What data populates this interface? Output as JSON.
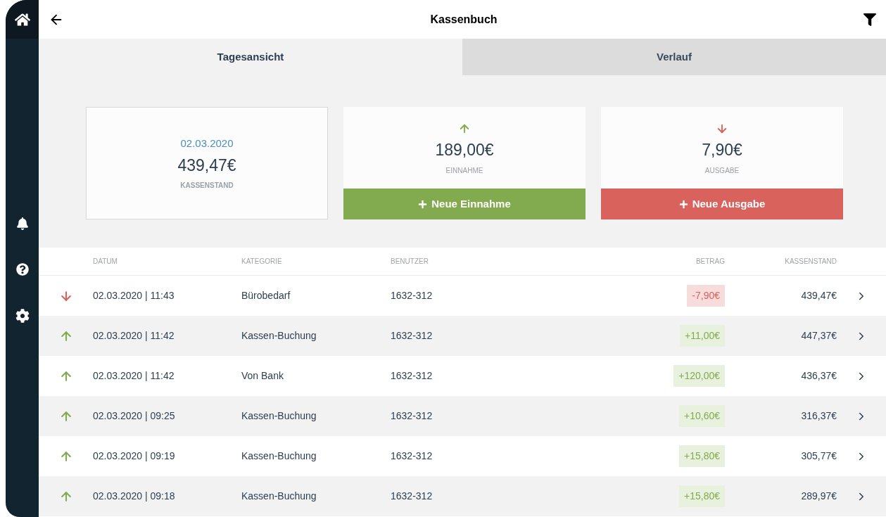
{
  "header": {
    "title": "Kassenbuch"
  },
  "tabs": [
    {
      "label": "Tagesansicht",
      "selected": true
    },
    {
      "label": "Verlauf",
      "selected": false
    }
  ],
  "balance_card": {
    "date": "02.03.2020",
    "amount": "439,47€",
    "label": "KASSENSTAND"
  },
  "summary_cards": [
    {
      "kind": "in",
      "amount": "189,00€",
      "label": "EINNAHME",
      "button": "Neue Einnahme"
    },
    {
      "kind": "out",
      "amount": "7,90€",
      "label": "AUSGABE",
      "button": "Neue Ausgabe"
    }
  ],
  "table": {
    "columns": [
      "DATUM",
      "KATEGORIE",
      "BENUTZER",
      "BETRAG",
      "KASSENSTAND"
    ],
    "rows": [
      {
        "kind": "out",
        "date": "02.03.2020 | 11:43",
        "category": "Bürobedarf",
        "user": "1632-312",
        "amount": "-7,90€",
        "balance": "439,47€"
      },
      {
        "kind": "in",
        "date": "02.03.2020 | 11:42",
        "category": "Kassen-Buchung",
        "user": "1632-312",
        "amount": "+11,00€",
        "balance": "447,37€"
      },
      {
        "kind": "in",
        "date": "02.03.2020 | 11:42",
        "category": "Von Bank",
        "user": "1632-312",
        "amount": "+120,00€",
        "balance": "436,37€"
      },
      {
        "kind": "in",
        "date": "02.03.2020 | 09:25",
        "category": "Kassen-Buchung",
        "user": "1632-312",
        "amount": "+10,60€",
        "balance": "316,37€"
      },
      {
        "kind": "in",
        "date": "02.03.2020 | 09:19",
        "category": "Kassen-Buchung",
        "user": "1632-312",
        "amount": "+15,80€",
        "balance": "305,77€"
      },
      {
        "kind": "in",
        "date": "02.03.2020 | 09:18",
        "category": "Kassen-Buchung",
        "user": "1632-312",
        "amount": "+15,80€",
        "balance": "289,97€"
      }
    ]
  }
}
